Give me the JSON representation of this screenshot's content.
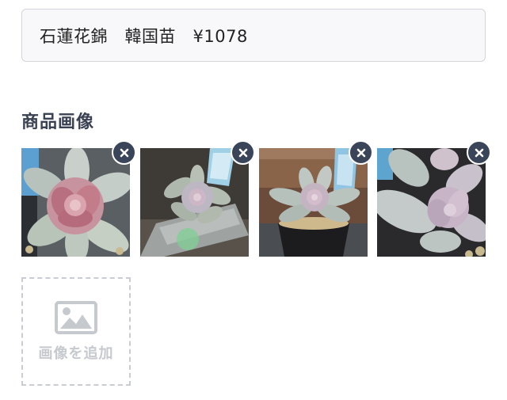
{
  "title_field": {
    "value": "石蓮花錦　韓国苗　¥1078"
  },
  "images_section": {
    "label": "商品画像",
    "images": [
      {
        "alt": "succulent-pink-center"
      },
      {
        "alt": "succulent-with-label-tag"
      },
      {
        "alt": "succulent-black-pot"
      },
      {
        "alt": "succulent-closeup"
      }
    ],
    "remove_icon": "close-icon",
    "add_image": {
      "label": "画像を追加",
      "icon": "image-icon"
    }
  },
  "colors": {
    "remove_button_bg": "#3a4559",
    "section_label": "#3a4152",
    "placeholder_gray": "#c6c9ce"
  }
}
